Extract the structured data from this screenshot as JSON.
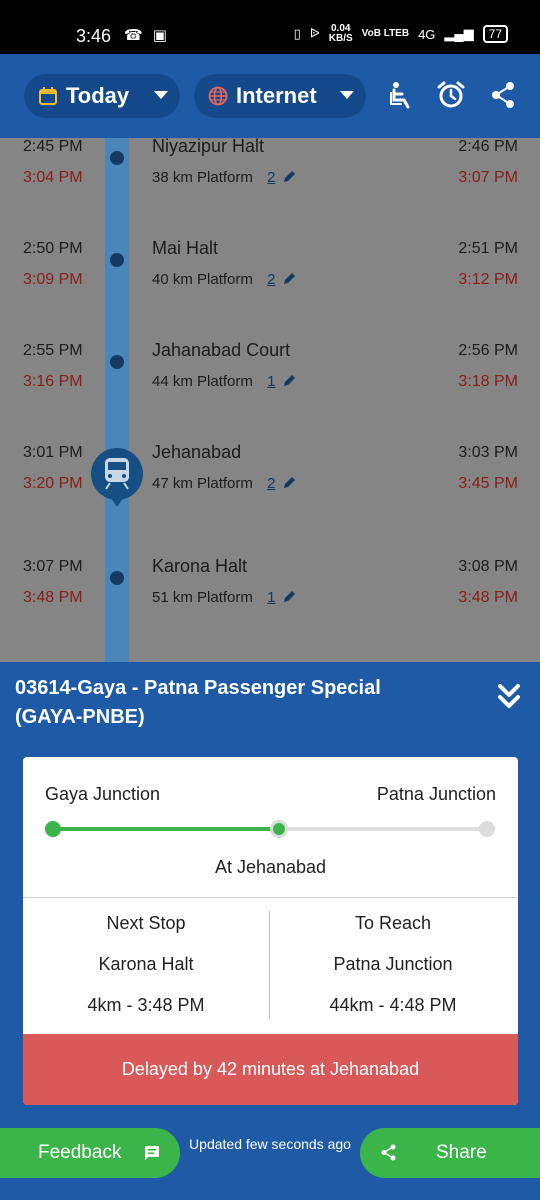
{
  "status_bar": {
    "time": "3:46",
    "speed_top": "0.04",
    "speed_unit": "KB/S",
    "volte": "VoB LTEB",
    "network": "4G",
    "battery": "77"
  },
  "app_bar": {
    "date_filter": "Today",
    "source_filter": "Internet",
    "icons": [
      "calendar-icon",
      "globe-icon",
      "accessible-seat-icon",
      "alarm-clock-icon",
      "share-icon"
    ]
  },
  "stops": [
    {
      "name": "Niyazipur Halt",
      "sched_arr": "2:45 PM",
      "actual_arr": "3:04 PM",
      "sched_dep": "2:46 PM",
      "actual_dep": "3:07 PM",
      "km": "38 km",
      "platform_label": "Platform",
      "platform": "2"
    },
    {
      "name": "Mai Halt",
      "sched_arr": "2:50 PM",
      "actual_arr": "3:09 PM",
      "sched_dep": "2:51 PM",
      "actual_dep": "3:12 PM",
      "km": "40 km",
      "platform_label": "Platform",
      "platform": "2"
    },
    {
      "name": "Jahanabad Court",
      "sched_arr": "2:55 PM",
      "actual_arr": "3:16 PM",
      "sched_dep": "2:56 PM",
      "actual_dep": "3:18 PM",
      "km": "44 km",
      "platform_label": "Platform",
      "platform": "1"
    },
    {
      "name": "Jehanabad",
      "sched_arr": "3:01 PM",
      "actual_arr": "3:20 PM",
      "sched_dep": "3:03 PM",
      "actual_dep": "3:45 PM",
      "km": "47 km",
      "platform_label": "Platform",
      "platform": "2"
    },
    {
      "name": "Karona Halt",
      "sched_arr": "3:07 PM",
      "actual_arr": "3:48 PM",
      "sched_dep": "3:08 PM",
      "actual_dep": "3:48 PM",
      "km": "51 km",
      "platform_label": "Platform",
      "platform": "1"
    }
  ],
  "train": {
    "title_line1": "03614-Gaya - Patna Passenger Special",
    "title_line2": "(GAYA-PNBE)"
  },
  "status_card": {
    "from_station": "Gaya Junction",
    "to_station": "Patna Junction",
    "progress_fraction": 0.52,
    "current_location": "At Jehanabad",
    "next_stop_header": "Next Stop",
    "next_stop_name": "Karona Halt",
    "next_stop_eta": "4km - 3:48 PM",
    "to_reach_header": "To Reach",
    "to_reach_name": "Patna Junction",
    "to_reach_eta": "44km - 4:48 PM",
    "delay_message": "Delayed by 42 minutes at Jehanabad"
  },
  "bottom": {
    "feedback_label": "Feedback",
    "updated_text": "Updated few seconds ago",
    "share_label": "Share"
  },
  "colors": {
    "primary": "#1e5aa6",
    "accent_green": "#3bb54a",
    "delay_red": "#d95858"
  }
}
